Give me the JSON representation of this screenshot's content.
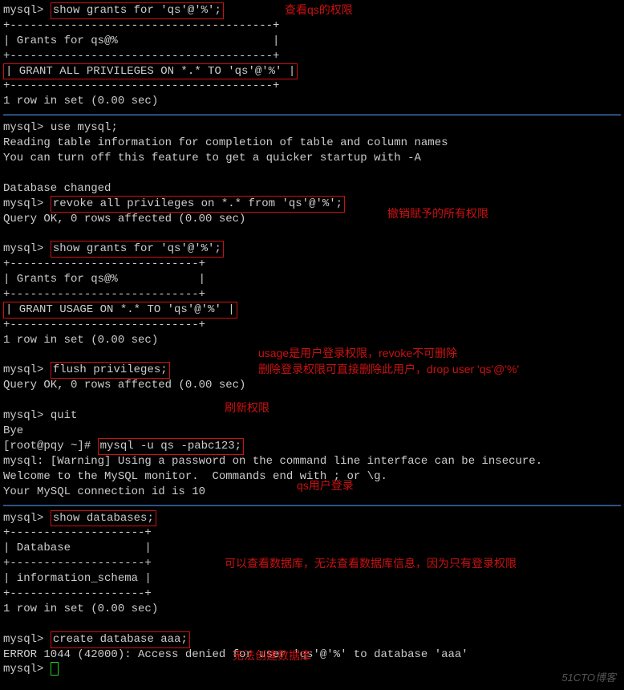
{
  "prompt_mysql": "mysql>",
  "prompt_shell": "[root@pqy ~]#",
  "cmds": {
    "show_grants1": "show grants for 'qs'@'%';",
    "use_mysql": "use mysql;",
    "revoke_all": "revoke all privileges on *.* from 'qs'@'%';",
    "show_grants2": "show grants for 'qs'@'%';",
    "flush_priv": "flush privileges;",
    "quit": "quit",
    "shell_login": "mysql -u qs -pabc123;",
    "show_db": "show databases;",
    "create_db": "create database aaa;"
  },
  "out": {
    "border1_top": "+---------------------------------------+",
    "grants_for_qs": "| Grants for qs@%                       |",
    "grant_all_row": "| GRANT ALL PRIVILEGES ON *.* TO 'qs'@'%' |",
    "one_row": "1 row in set (0.00 sec)",
    "reading_info": "Reading table information for completion of table and column names",
    "turn_off": "You can turn off this feature to get a quicker startup with -A",
    "db_changed": "Database changed",
    "query_ok": "Query OK, 0 rows affected (0.00 sec)",
    "border2_top": "+----------------------------+",
    "grants_for_qs2": "| Grants for qs@%            |",
    "grant_usage": "| GRANT USAGE ON *.* TO 'qs'@'%' |",
    "bye": "Bye",
    "warning": "mysql: [Warning] Using a password on the command line interface can be insecure.",
    "welcome": "Welcome to the MySQL monitor.  Commands end with ; or \\g.",
    "conn_id": "Your MySQL connection id is 10",
    "border3_top": "+--------------------+",
    "db_header": "| Database           |",
    "info_schema": "| information_schema |",
    "error_1044": "ERROR 1044 (42000): Access denied for user 'qs'@'%' to database 'aaa'"
  },
  "annots": {
    "a1": "查看qs的权限",
    "a2": "撤销赋予的所有权限",
    "a3a": "usage是用户登录权限，revoke不可删除",
    "a3b": "删除登录权限可直接删除此用户，drop user 'qs'@'%'",
    "a4": "刷新权限",
    "a5": "qs用户登录",
    "a6": "可以查看数据库，无法查看数据库信息，因为只有登录权限",
    "a7": "无法创建数据库"
  },
  "watermark": "51CTO博客"
}
